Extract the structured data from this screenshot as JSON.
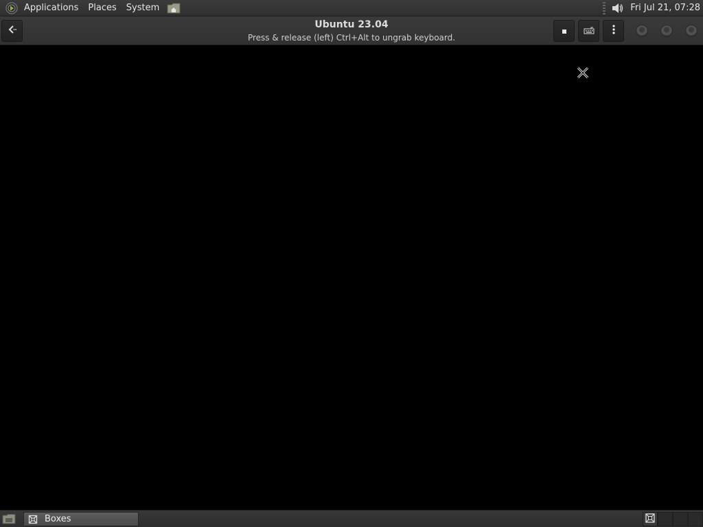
{
  "top_panel": {
    "menus": [
      "Applications",
      "Places",
      "System"
    ],
    "clock": "Fri Jul 21, 07:28",
    "icons": {
      "menu_logo": "distro-menu-icon",
      "home_launcher": "home-folder-icon",
      "volume": "speaker-volume-icon"
    }
  },
  "headerbar": {
    "title": "Ubuntu 23.04",
    "subtitle": "Press & release (left) Ctrl+Alt to ungrab keyboard.",
    "icons": {
      "back": "back-arrow-icon",
      "stop": "stop-square-icon",
      "keyboard": "keyboard-icon",
      "menu": "kebab-menu-icon",
      "minimize": "minimize-icon",
      "maximize": "maximize-icon",
      "close": "close-icon"
    }
  },
  "vm_display": {
    "background": "#000000",
    "cursor_icon": "x-cursor-icon"
  },
  "taskbar": {
    "tasks": [
      {
        "label": "Boxes",
        "icon": "boxes-app-icon"
      }
    ],
    "icons": {
      "show_desktop": "show-desktop-icon",
      "workspace_active": "workspace-window-icon"
    }
  },
  "colors": {
    "panel_bg": "#333333",
    "headerbar_bg": "#363636",
    "text": "#e6e6e6",
    "active_task": "#555555"
  }
}
